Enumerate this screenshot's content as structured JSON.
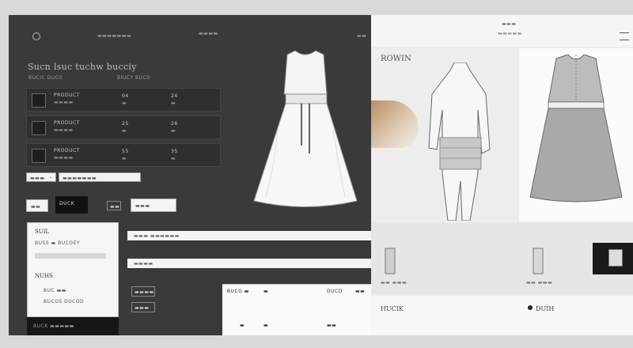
{
  "dark": {
    "nav_center": "▬▬▬▬▬▬▬",
    "nav_right": "▬▬▬▬",
    "nav_far": "▬▬",
    "heading": "Sucn lsuc tuchw bucciy",
    "sub_left": "BUCIC  DUCG",
    "sub_right": "BIUCY  BUCD",
    "rows": [
      {
        "name": "PRODUCT",
        "sub": "▬▬▬▬",
        "v1": "04",
        "v1b": "▬",
        "v2": "24",
        "v2b": "▬"
      },
      {
        "name": "PRODUCT",
        "sub": "▬▬▬▬",
        "v1": "25",
        "v1b": "▬",
        "v2": "26",
        "v2b": "▬"
      },
      {
        "name": "PRODUCT",
        "sub": "▬▬▬▬",
        "v1": "55",
        "v1b": "▬",
        "v2": "35",
        "v2b": "▬"
      }
    ],
    "select_value": "▬▬▬",
    "input_value": "▬▬▬▬▬▬▬",
    "btn_outline_a": "▬▬",
    "btn_dark": "DUCK",
    "btn_light_a": "▬▬",
    "btn_light_b": "▬▬▬",
    "card_title": "SUIL",
    "card_line": "BUSS ▬ BUCOEY",
    "card_title2": "NUHS",
    "card_items": [
      "BUC ▬▬",
      "BUCOS DUCOD"
    ],
    "strip_a": "▬▬▬ ▬▬▬▬▬▬",
    "strip_b": "▬▬▬▬",
    "small_btn_a": "▬▬▬▬",
    "small_btn_b": "▬▬▬",
    "footer_text": "BUCK  ▬▬▬▬▬",
    "table_cols": [
      "BUCG ▬",
      "▬",
      "DUCD",
      "▬▬"
    ],
    "table_rows": [
      "▬",
      "▬",
      "▬▬"
    ]
  },
  "light": {
    "brand": "▬▬▬",
    "brand_sub": "▬▬▬▬▬",
    "menu_icon": "hamburger-icon",
    "section_label": "ROWIN",
    "price_a": "▬▬ ▬▬▬",
    "price_b": "▬▬ ▬▬▬",
    "footer_left": "HUCIK",
    "footer_right": "DUIH"
  }
}
